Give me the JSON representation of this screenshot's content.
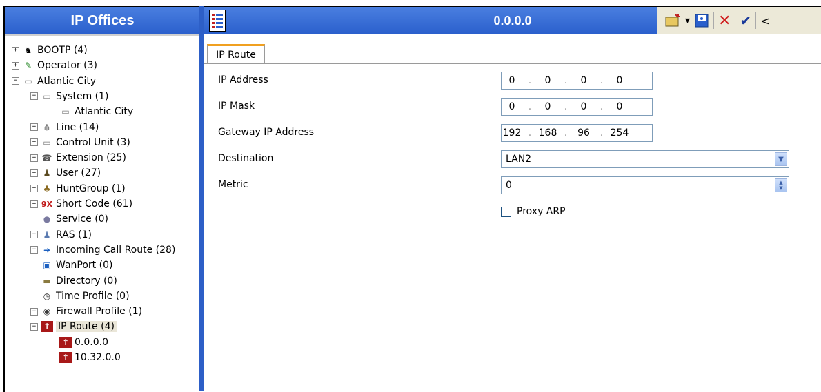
{
  "left_panel": {
    "title": "IP Offices",
    "tree": [
      {
        "label": "BOOTP (4)",
        "icon": "bootp-icon",
        "glyph": "♞",
        "color": "#000",
        "pm": "+"
      },
      {
        "label": "Operator (3)",
        "icon": "operator-icon",
        "glyph": "✎",
        "color": "#2a8a2a",
        "pm": "+"
      },
      {
        "label": "Atlantic City",
        "icon": "ip-office-icon",
        "glyph": "▭",
        "color": "#777",
        "pm": "−"
      },
      {
        "label": "System (1)",
        "icon": "system-icon",
        "glyph": "▭",
        "color": "#777",
        "pm": "−"
      },
      {
        "label": "Atlantic City",
        "icon": "system-unit-icon",
        "glyph": "▭",
        "color": "#777",
        "pm": ""
      },
      {
        "label": "Line (14)",
        "icon": "line-icon",
        "glyph": "⫛",
        "color": "#444",
        "pm": "+"
      },
      {
        "label": "Control Unit (3)",
        "icon": "control-unit-icon",
        "glyph": "▭",
        "color": "#777",
        "pm": "+"
      },
      {
        "label": "Extension (25)",
        "icon": "extension-icon",
        "glyph": "☎",
        "color": "#555",
        "pm": "+"
      },
      {
        "label": "User (27)",
        "icon": "user-icon",
        "glyph": "♟",
        "color": "#5a4a20",
        "pm": "+"
      },
      {
        "label": "HuntGroup (1)",
        "icon": "huntgroup-icon",
        "glyph": "♣",
        "color": "#8a6a20",
        "pm": "+"
      },
      {
        "label": "Short Code (61)",
        "icon": "short-code-icon",
        "glyph": "9X",
        "color": "#c01818",
        "pm": "+"
      },
      {
        "label": "Service (0)",
        "icon": "service-icon",
        "glyph": "●",
        "color": "#7a7aa0",
        "pm": ""
      },
      {
        "label": "RAS (1)",
        "icon": "ras-icon",
        "glyph": "♟",
        "color": "#5a7ab0",
        "pm": "+"
      },
      {
        "label": "Incoming Call Route (28)",
        "icon": "incoming-call-route-icon",
        "glyph": "➜",
        "color": "#1a5fc0",
        "pm": "+"
      },
      {
        "label": "WanPort (0)",
        "icon": "wanport-icon",
        "glyph": "▣",
        "color": "#1a5fc0",
        "pm": ""
      },
      {
        "label": "Directory (0)",
        "icon": "directory-icon",
        "glyph": "▬",
        "color": "#8a7a40",
        "pm": ""
      },
      {
        "label": "Time Profile (0)",
        "icon": "time-profile-icon",
        "glyph": "◷",
        "color": "#333",
        "pm": ""
      },
      {
        "label": "Firewall Profile (1)",
        "icon": "firewall-profile-icon",
        "glyph": "◉",
        "color": "#3a3a3a",
        "pm": "+"
      },
      {
        "label": "IP Route (4)",
        "icon": "ip-route-icon",
        "glyph": "↑",
        "color": "#a81818",
        "pm": "−",
        "selected": true
      },
      {
        "label": "0.0.0.0",
        "icon": "ip-route-entry-icon",
        "glyph": "↑",
        "color": "#a81818",
        "pm": ""
      },
      {
        "label": "10.32.0.0",
        "icon": "ip-route-entry-icon",
        "glyph": "↑",
        "color": "#a81818",
        "pm": ""
      }
    ]
  },
  "right_panel": {
    "title": "0.0.0.0",
    "toolbar": {
      "new_icon": "new-record-icon",
      "dropdown": "▾",
      "save_icon": "save-icon",
      "delete_icon": "delete-icon",
      "ok_icon": "ok-icon",
      "back_icon": "back-icon",
      "delete_glyph": "✕",
      "ok_glyph": "✔",
      "back_glyph": "<"
    },
    "tab_label": "IP Route",
    "fields": {
      "ip_address_label": "IP Address",
      "ip_address": [
        "0",
        "0",
        "0",
        "0"
      ],
      "ip_mask_label": "IP Mask",
      "ip_mask": [
        "0",
        "0",
        "0",
        "0"
      ],
      "gateway_label": "Gateway IP Address",
      "gateway": [
        "192",
        "168",
        "96",
        "254"
      ],
      "destination_label": "Destination",
      "destination_value": "LAN2",
      "metric_label": "Metric",
      "metric_value": "0",
      "proxy_arp_label": "Proxy ARP",
      "proxy_arp_checked": false
    }
  }
}
